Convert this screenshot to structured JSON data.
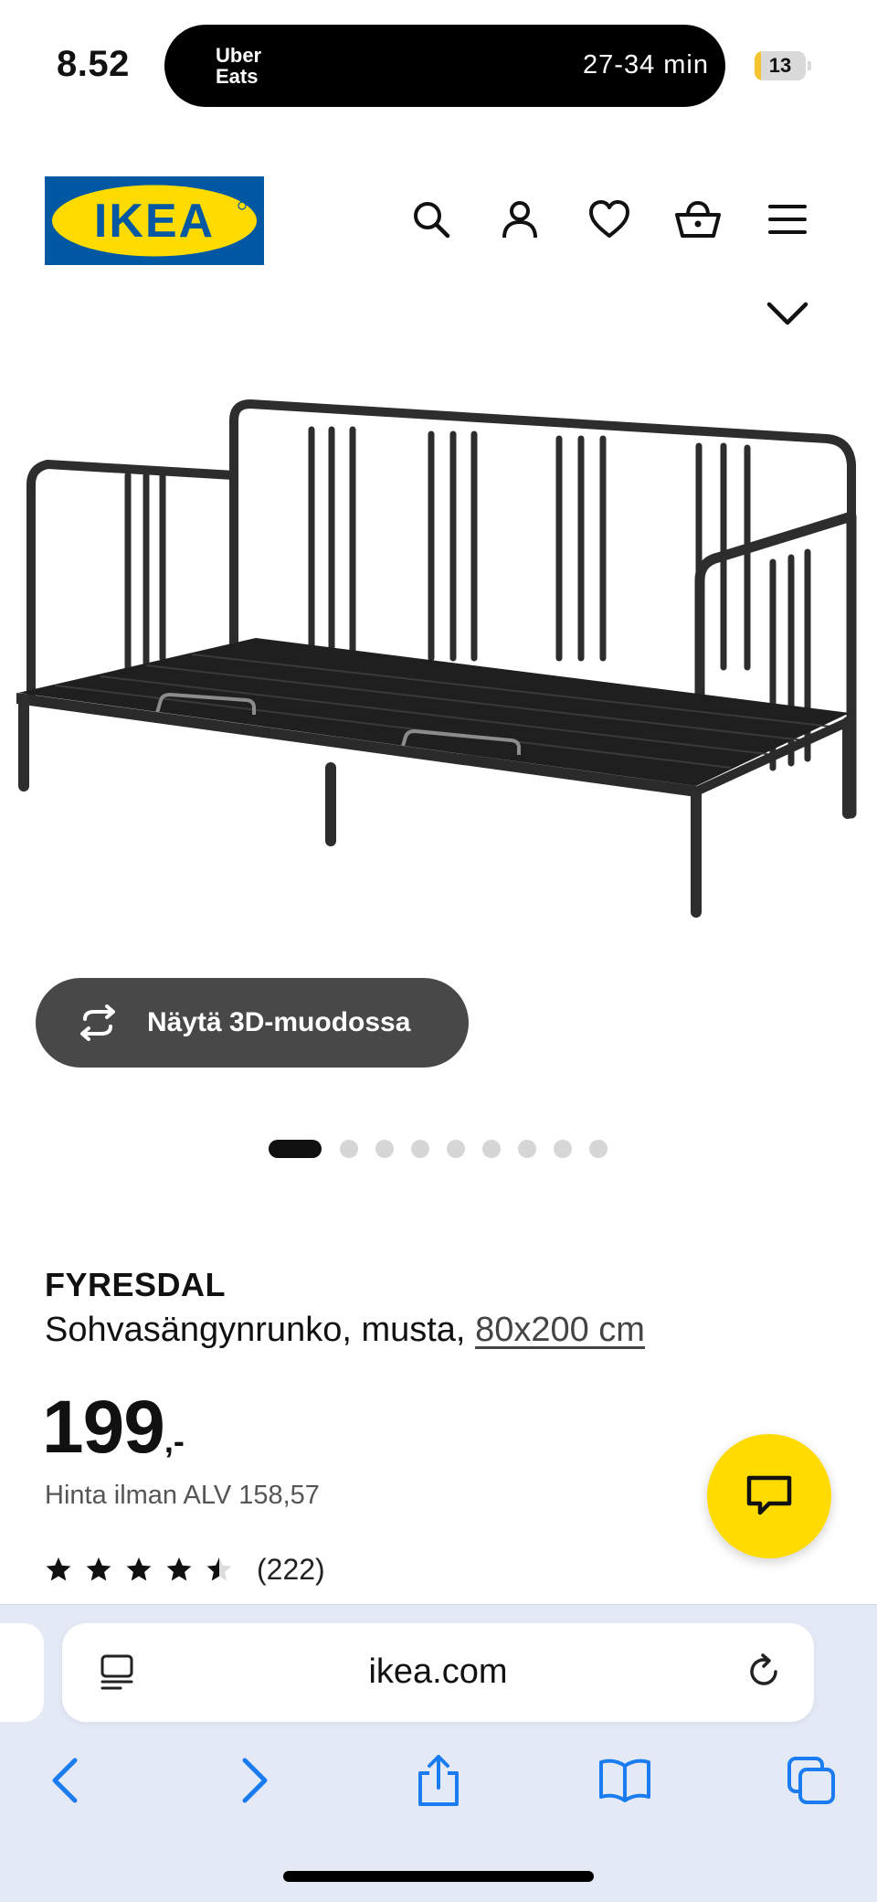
{
  "status_bar": {
    "time": "8.52",
    "live_activity": {
      "brand": "Uber\nEats",
      "eta": "27-34 min"
    },
    "battery": {
      "level": "13",
      "fill_fraction": 0.13
    }
  },
  "header": {
    "logo_text": "IKEA",
    "icons": [
      "search-icon",
      "account-icon",
      "heart-icon",
      "basket-icon",
      "menu-icon"
    ]
  },
  "gallery": {
    "view_3d_label": "Näytä 3D-muodossa",
    "total_images": 9,
    "active_index": 0
  },
  "product": {
    "name": "FYRESDAL",
    "description": "Sohvasängynrunko, musta, ",
    "size_link": "80x200 cm",
    "price": "199",
    "price_suffix": ",-",
    "price_vat": "Hinta ilman ALV 158,57",
    "rating": 4.5,
    "review_count": "(222)"
  },
  "browser": {
    "url": "ikea.com"
  },
  "colors": {
    "ikea_blue": "#0058a3",
    "ikea_yellow": "#ffdb00",
    "safari_blue": "#1a7cf0"
  }
}
